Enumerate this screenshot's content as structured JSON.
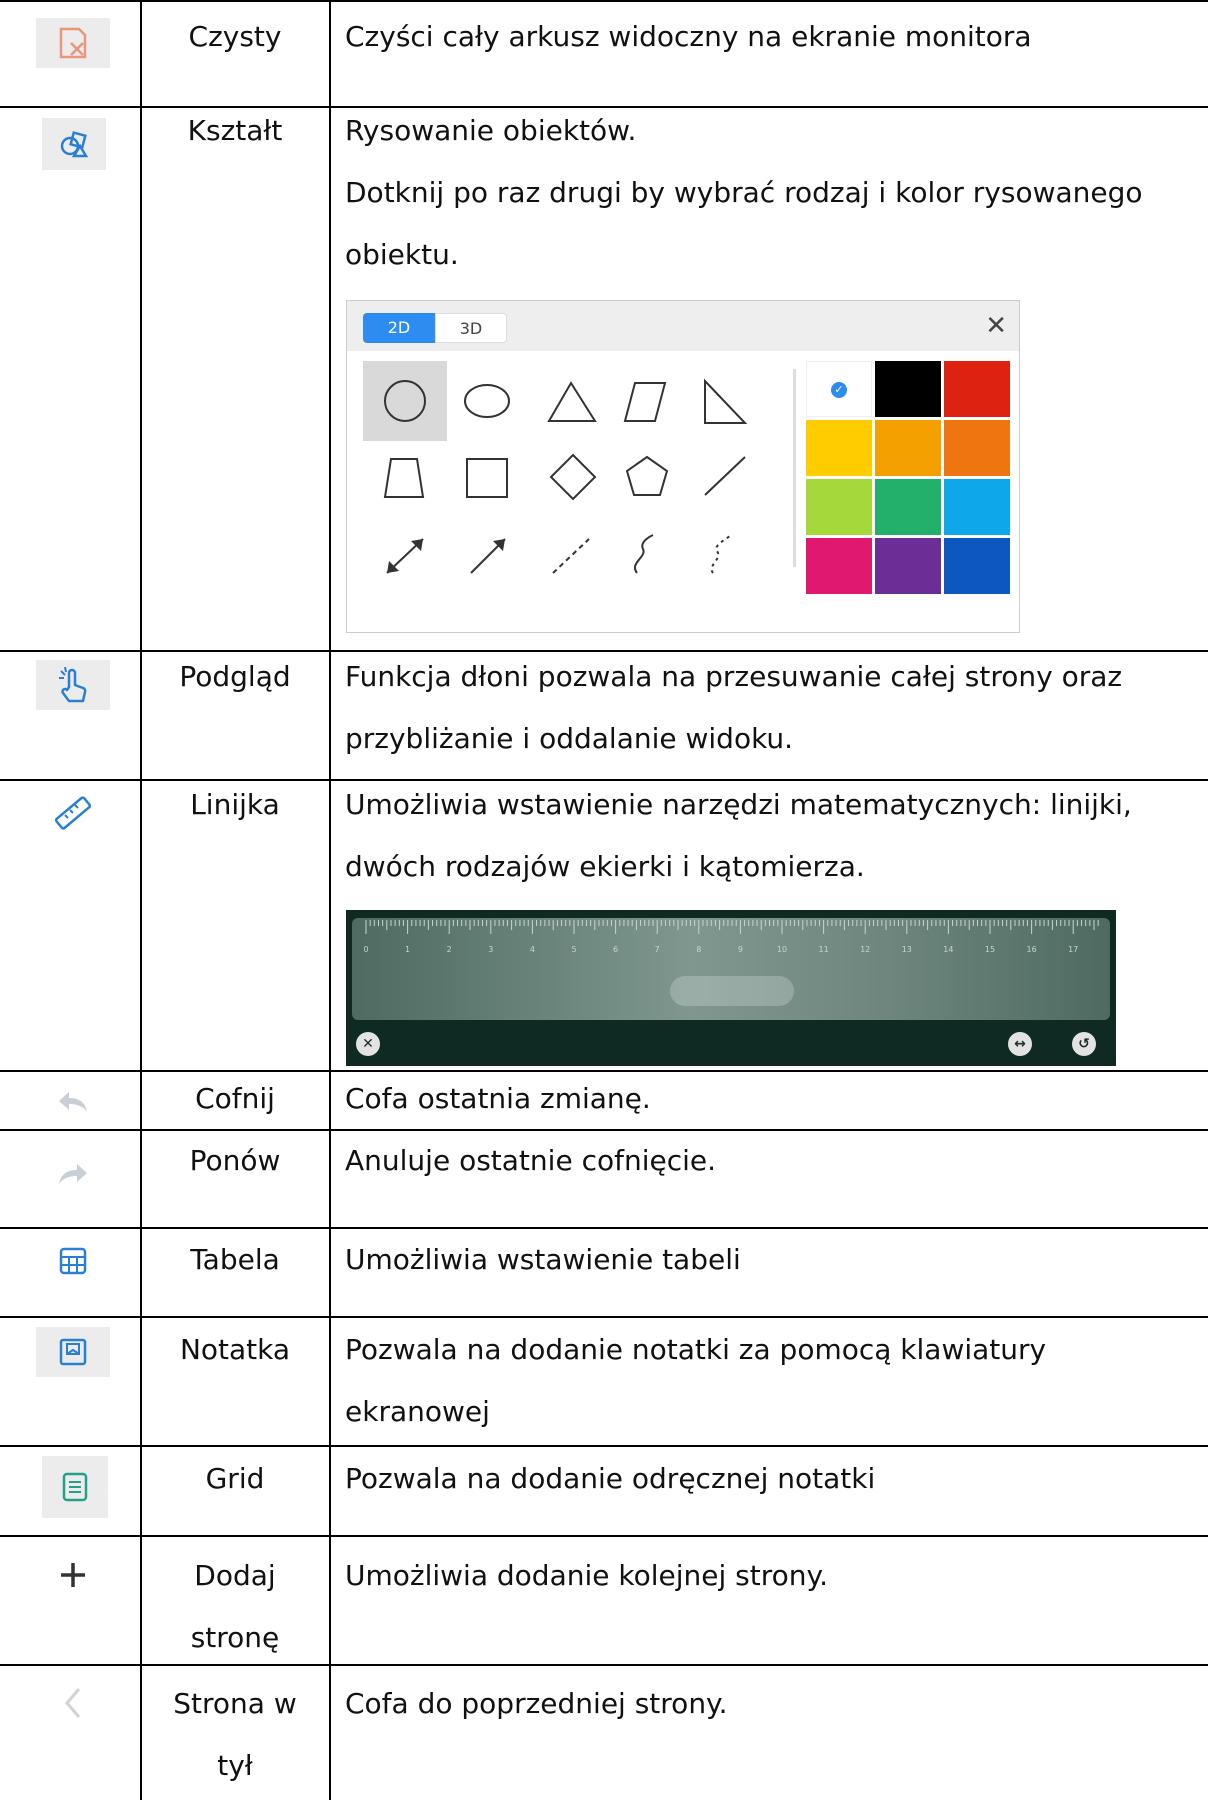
{
  "rows": [
    {
      "name": "Czysty",
      "icon": "clear-page-icon",
      "desc": [
        "Czyści cały arkusz widoczny na ekranie monitora"
      ]
    },
    {
      "name": "Kształt",
      "icon": "shapes-icon",
      "desc": [
        "Rysowanie obiektów.",
        "Dotknij po raz drugi by wybrać rodzaj i kolor rysowanego",
        "obiektu."
      ]
    },
    {
      "name": "Podgląd",
      "icon": "hand-pointer-icon",
      "desc": [
        "Funkcja dłoni pozwala na przesuwanie całej strony oraz",
        "przybliżanie i oddalanie widoku."
      ]
    },
    {
      "name": "Linijka",
      "icon": "ruler-icon",
      "desc": [
        "Umożliwia wstawienie narzędzi matematycznych: linijki,",
        "dwóch rodzajów ekierki i kątomierza."
      ]
    },
    {
      "name": "Cofnij",
      "icon": "undo-icon",
      "desc": [
        "Cofa ostatnia zmianę."
      ]
    },
    {
      "name": "Ponów",
      "icon": "redo-icon",
      "desc": [
        "Anuluje ostatnie cofnięcie."
      ]
    },
    {
      "name": "Tabela",
      "icon": "table-icon",
      "desc": [
        "Umożliwia wstawienie tabeli"
      ]
    },
    {
      "name": "Notatka",
      "icon": "note-icon",
      "desc": [
        "Pozwala na dodanie notatki za pomocą klawiatury",
        "ekranowej"
      ]
    },
    {
      "name": "Grid",
      "icon": "grid-note-icon",
      "desc": [
        "Pozwala na dodanie odręcznej notatki"
      ]
    },
    {
      "name": [
        "Dodaj",
        "stronę"
      ],
      "icon": "plus-icon",
      "desc": [
        "Umożliwia dodanie kolejnej strony."
      ]
    },
    {
      "name": [
        "Strona w",
        "tył"
      ],
      "icon": "chevron-left-icon",
      "desc": [
        "Cofa do poprzedniej strony."
      ]
    }
  ],
  "shape_panel": {
    "tabs": [
      "2D",
      "3D"
    ],
    "active_tab": "2D",
    "selected_color_index": 0,
    "colors": [
      "#ffffff",
      "#000000",
      "#dd2211",
      "#ffcc00",
      "#f4a000",
      "#ef7511",
      "#a5d83a",
      "#22b06b",
      "#0ea7ea",
      "#e0186f",
      "#6b2d96",
      "#0c58c0"
    ],
    "shapes": [
      "circle",
      "ellipse",
      "triangle",
      "parallelogram",
      "right-triangle",
      "trapezoid",
      "square",
      "diamond",
      "pentagon",
      "line",
      "double-arrow",
      "arrow",
      "dashed-line",
      "curve",
      "dashed-curve"
    ]
  },
  "ruler_panel": {
    "ticks": [
      "0",
      "1",
      "2",
      "3",
      "4",
      "5",
      "6",
      "7",
      "8",
      "9",
      "10",
      "11",
      "12",
      "13",
      "14",
      "15",
      "16",
      "17"
    ]
  }
}
